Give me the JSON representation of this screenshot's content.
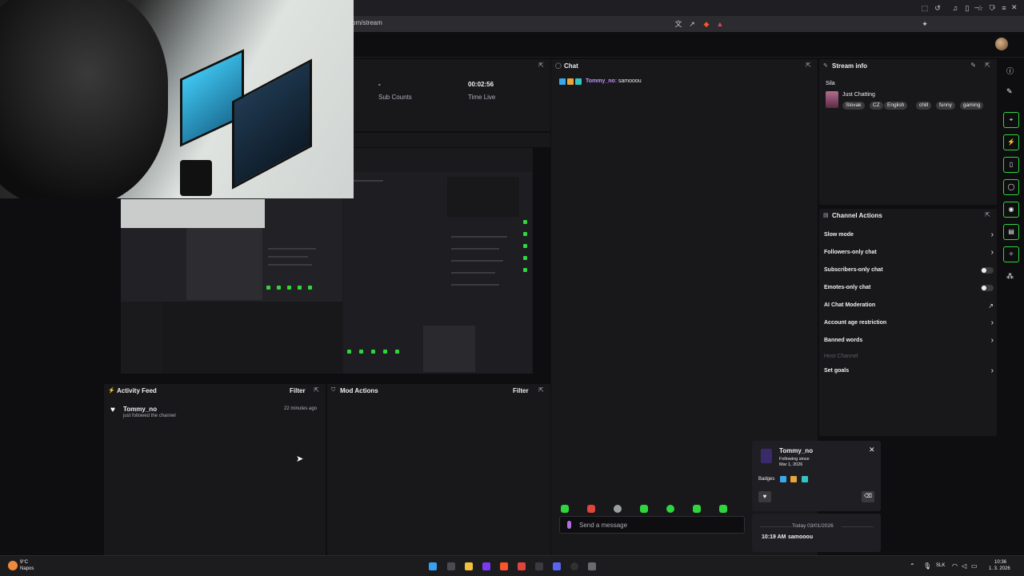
{
  "browser": {
    "url": "om/stream",
    "window_controls": [
      "–",
      "▫",
      "✕"
    ]
  },
  "webcam": {
    "label": ""
  },
  "stats": {
    "sub_value": "-",
    "sub_label": "Sub Counts",
    "time_value": "00:02:56",
    "time_label": "Time Live"
  },
  "activity_feed": {
    "title": "Activity Feed",
    "filter": "Filter",
    "items": [
      {
        "user": "Tommy_no",
        "text": "just followed the channel",
        "time": "22 minutes ago"
      }
    ]
  },
  "mod_actions": {
    "title": "Mod Actions",
    "filter": "Filter"
  },
  "chat": {
    "title": "Chat",
    "messages": [
      {
        "user": "Tommy_no",
        "text": ": samooou"
      }
    ],
    "input_placeholder": "Send a message"
  },
  "stream_info": {
    "title": "Stream info",
    "stream_title": "Sila",
    "category": "Just Chatting",
    "tags": [
      "Slovak",
      "CZ",
      "English",
      "chill",
      "funny",
      "gaming"
    ]
  },
  "channel_actions": {
    "title": "Channel Actions",
    "rows": [
      {
        "label": "Slow mode",
        "control": "chevron"
      },
      {
        "label": "Followers-only chat",
        "control": "chevron"
      },
      {
        "label": "Subscribers-only chat",
        "control": "toggle"
      },
      {
        "label": "Emotes-only chat",
        "control": "toggle"
      },
      {
        "label": "AI Chat Moderation",
        "control": "external"
      },
      {
        "label": "Account age restriction",
        "control": "chevron"
      },
      {
        "label": "Banned words",
        "control": "chevron"
      },
      {
        "label": "Host Channel",
        "control": "disabled"
      },
      {
        "label": "Set goals",
        "control": "chevron"
      }
    ]
  },
  "user_card": {
    "username": "Tommy_no",
    "following_line1": "Following since",
    "following_line2": "Mar 1, 2026",
    "badges_label": "Badges"
  },
  "history": {
    "date": "Today 03/01/2026",
    "time": "10:19 AM",
    "message": "samooou"
  },
  "taskbar": {
    "weather_temp": "9°C",
    "weather_place": "Napos",
    "lang": "SLK",
    "time": "10:36",
    "date": "1. 3. 2026"
  },
  "colors": {
    "accent_green": "#2fd63d",
    "panel_bg": "#18181b",
    "page_bg": "#0e0e10",
    "username_purple": "#bf94ff"
  }
}
